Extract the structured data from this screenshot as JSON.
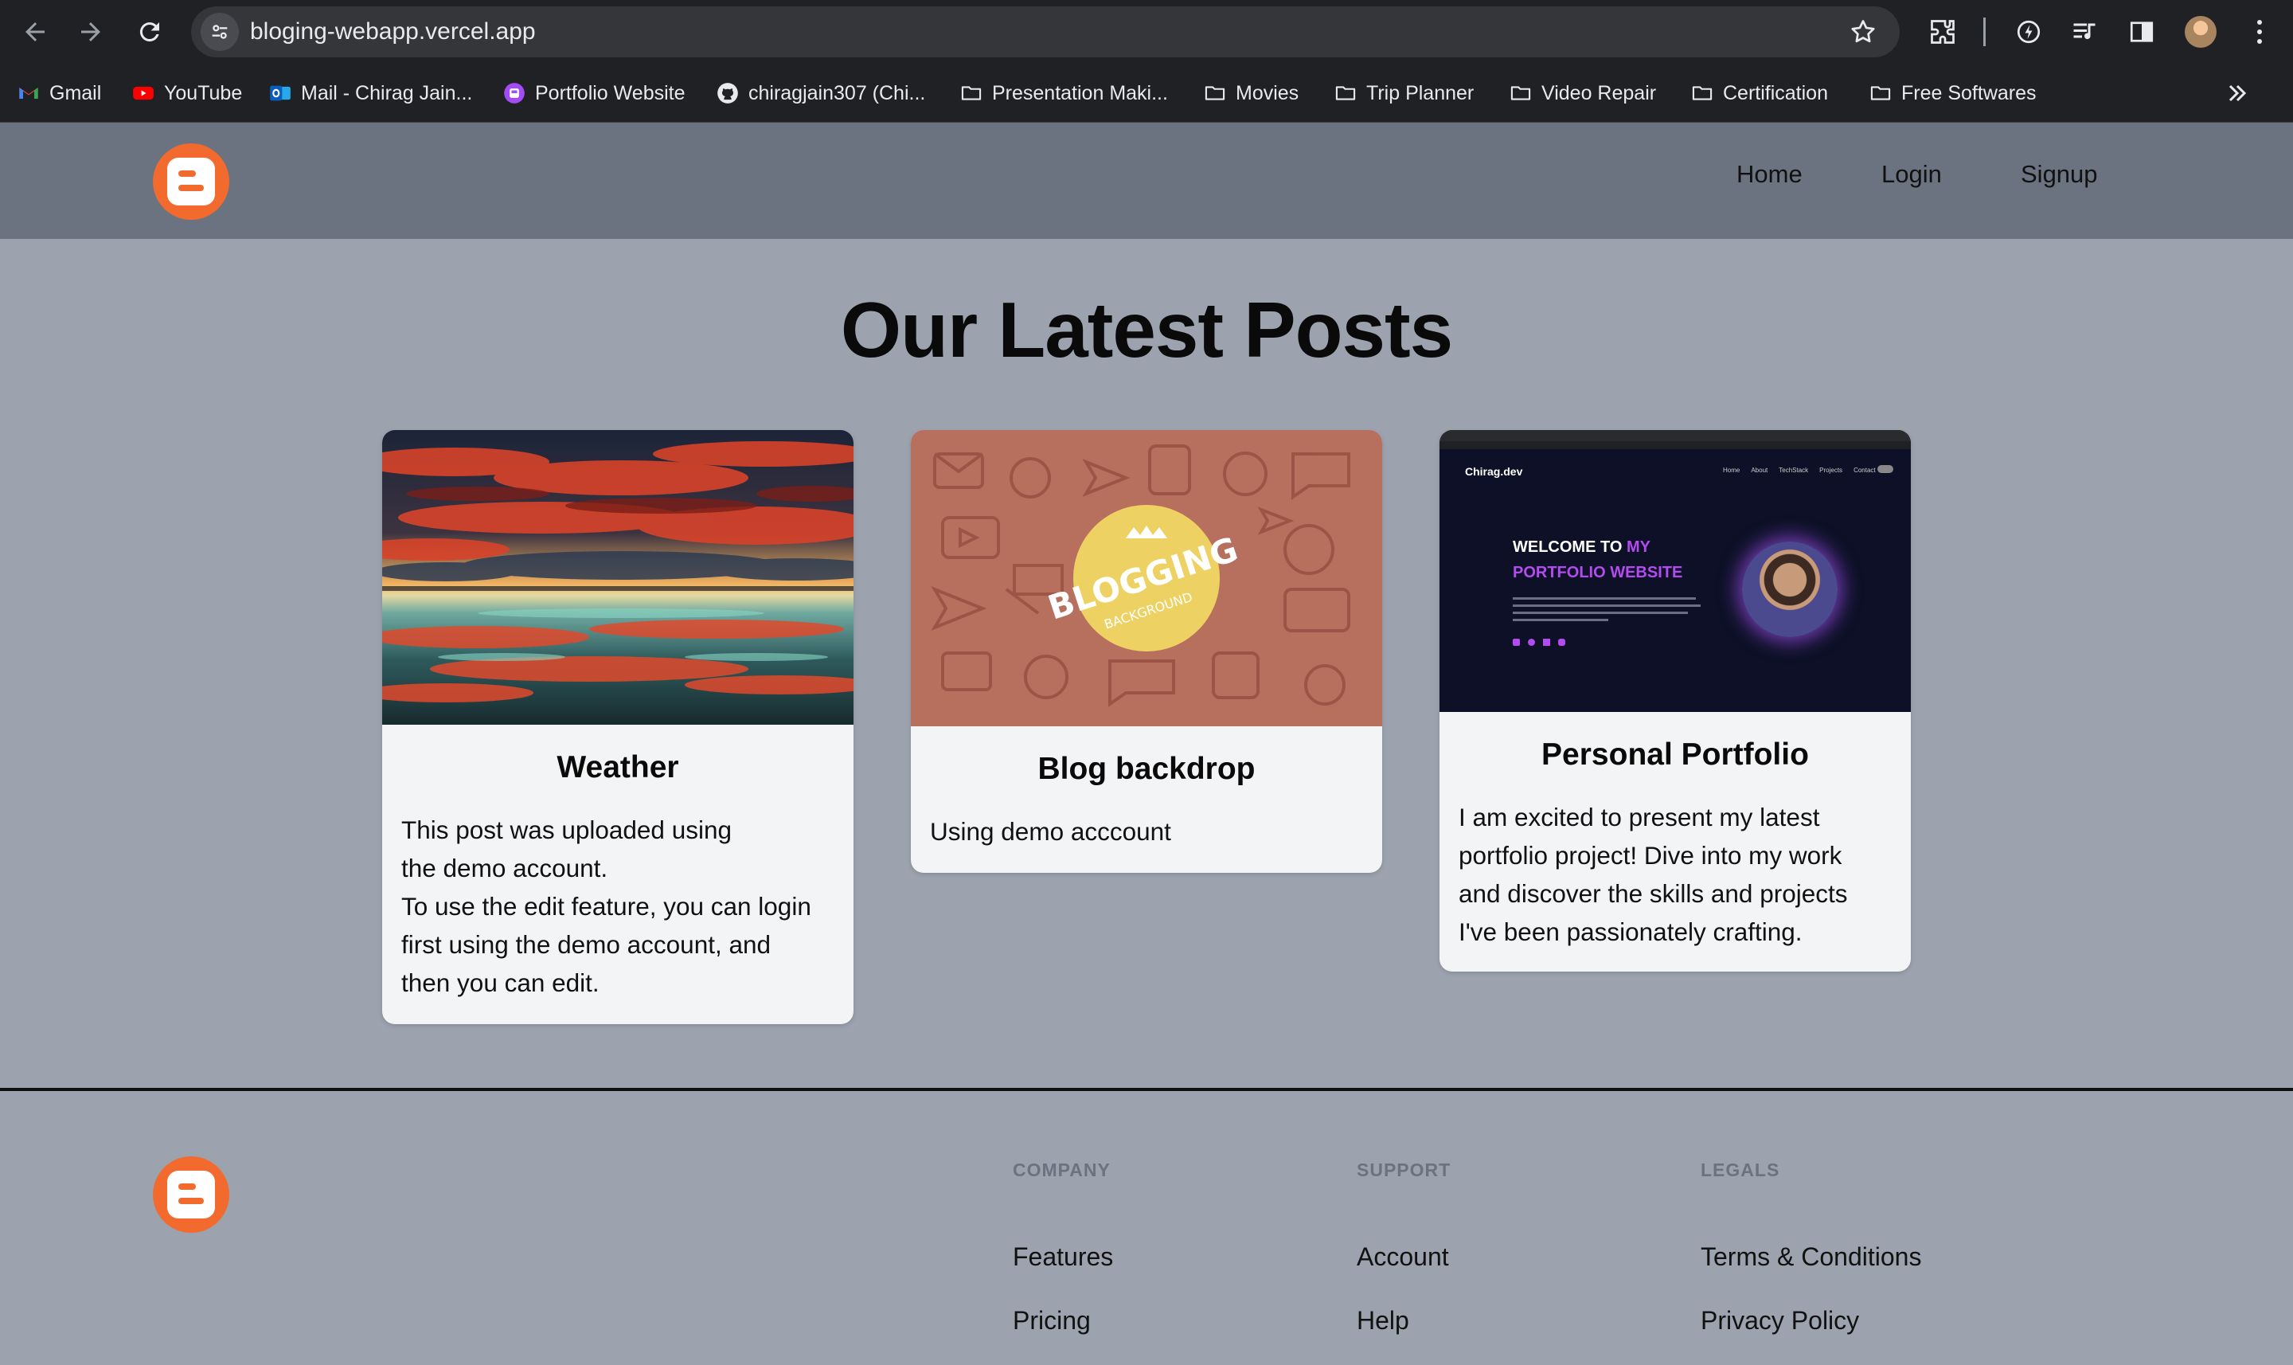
{
  "browser": {
    "url": "bloging-webapp.vercel.app",
    "bookmarks": [
      {
        "label": "Gmail",
        "icon": "gmail-icon"
      },
      {
        "label": "YouTube",
        "icon": "youtube-icon"
      },
      {
        "label": "Mail - Chirag Jain...",
        "icon": "outlook-icon"
      },
      {
        "label": "Portfolio Website",
        "icon": "portfolio-icon"
      },
      {
        "label": "chiragjain307 (Chi...",
        "icon": "github-icon"
      },
      {
        "label": "Presentation Maki...",
        "icon": "folder-icon"
      },
      {
        "label": "Movies",
        "icon": "folder-icon"
      },
      {
        "label": "Trip Planner",
        "icon": "folder-icon"
      },
      {
        "label": "Video Repair",
        "icon": "folder-icon"
      },
      {
        "label": "Certification",
        "icon": "folder-icon"
      },
      {
        "label": "Free Softwares",
        "icon": "folder-icon"
      }
    ]
  },
  "header": {
    "nav": [
      {
        "label": "Home"
      },
      {
        "label": "Login"
      },
      {
        "label": "Signup"
      }
    ]
  },
  "main": {
    "title": "Our Latest Posts",
    "posts": [
      {
        "title": "Weather",
        "body": [
          "This post was uploaded using",
          "the demo account.",
          "To use the edit feature, you can login",
          "first using the demo account, and",
          "then you can edit."
        ]
      },
      {
        "title": "Blog backdrop",
        "body": [
          "Using demo acccount"
        ],
        "image_text": {
          "main": "BLOGGING",
          "sub": "BACKGROUND"
        }
      },
      {
        "title": "Personal Portfolio",
        "body": [
          "I am excited to present my latest",
          "portfolio project! Dive into my work",
          "and discover the skills and projects",
          "I've been passionately crafting."
        ],
        "image_text": {
          "brand": "Chirag.dev",
          "nav": [
            "Home",
            "About",
            "TechStack",
            "Projects",
            "Contact"
          ],
          "headline_1": "WELCOME TO",
          "headline_1b": "MY",
          "headline_2": "PORTFOLIO WEBSITE"
        }
      }
    ]
  },
  "footer": {
    "columns": [
      {
        "heading": "COMPANY",
        "links": [
          "Features",
          "Pricing"
        ]
      },
      {
        "heading": "SUPPORT",
        "links": [
          "Account",
          "Help"
        ]
      },
      {
        "heading": "LEGALS",
        "links": [
          "Terms & Conditions",
          "Privacy Policy"
        ]
      }
    ]
  },
  "colors": {
    "brand_orange": "#f26a2e",
    "header_bg": "#6b7280",
    "page_bg": "#9ca3af",
    "card_bg": "#f3f4f6"
  }
}
